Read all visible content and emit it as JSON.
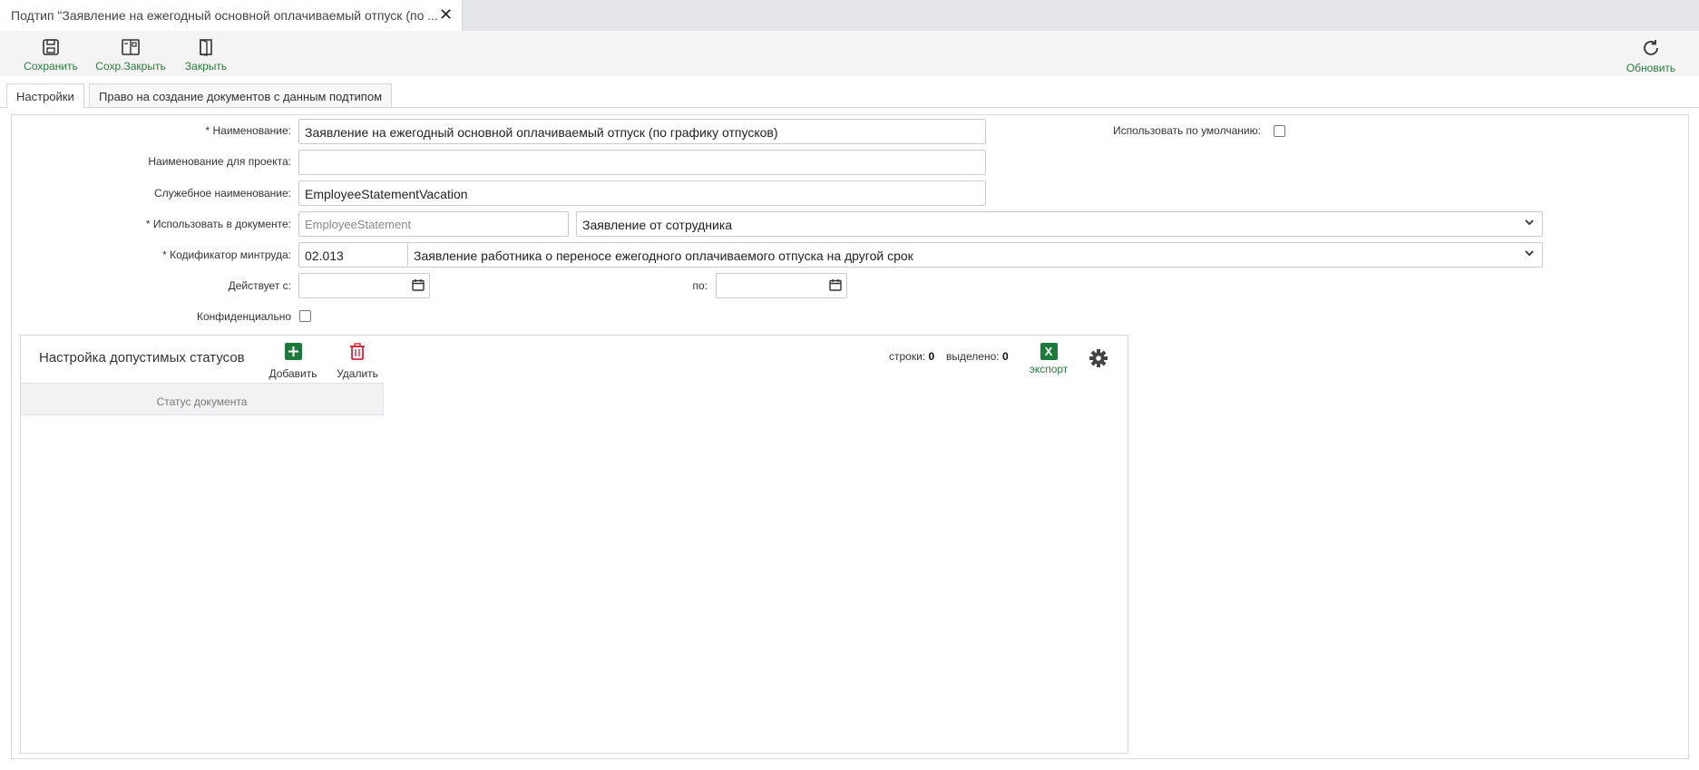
{
  "doc_tab": {
    "title": "Подтип \"Заявление на ежегодный основной оплачиваемый отпуск (по ..."
  },
  "toolbar": {
    "save_label": "Сохранить",
    "save_close_label": "Сохр.Закрыть",
    "close_label": "Закрыть",
    "refresh_label": "Обновить"
  },
  "tabs": [
    {
      "label": "Настройки",
      "active": true
    },
    {
      "label": "Право на создание документов с данным подтипом",
      "active": false
    }
  ],
  "form": {
    "name_label": "* Наименование:",
    "name_value": "Заявление на ежегодный основной оплачиваемый отпуск (по графику отпусков)",
    "default_label": "Использовать по умолчанию:",
    "default_checked": false,
    "project_name_label": "Наименование для проекта:",
    "project_name_value": "",
    "service_name_label": "Служебное наименование:",
    "service_name_value": "EmployeeStatementVacation",
    "use_in_doc_label": "* Использовать в документе:",
    "use_in_doc_code": "EmployeeStatement",
    "use_in_doc_value": "Заявление от сотрудника",
    "codifier_label": "* Кодификатор минтруда:",
    "codifier_code": "02.013",
    "codifier_value": "Заявление работника о переносе ежегодного оплачиваемого отпуска на другой срок",
    "valid_from_label": "Действует с:",
    "valid_from_value": "",
    "valid_to_label": "по:",
    "valid_to_value": "",
    "confidential_label": "Конфиденциально",
    "confidential_checked": false
  },
  "statuses_grid": {
    "title": "Настройка допустимых статусов",
    "add_label": "Добавить",
    "delete_label": "Удалить",
    "rows_label": "строки:",
    "rows_count": "0",
    "selected_label": "выделено:",
    "selected_count": "0",
    "export_label": "экспорт",
    "export_icon_text": "X",
    "column_header": "Статус документа",
    "rows": []
  },
  "colors": {
    "accent_green": "#2a7a3b",
    "delete_red": "#d0263a",
    "excel_green": "#1d7a3c"
  },
  "icons": [
    "save-icon",
    "save-close-icon",
    "close-door-icon",
    "refresh-icon",
    "calendar-icon",
    "plus-icon",
    "trash-icon",
    "excel-icon",
    "gear-icon",
    "chevron-down-icon",
    "close-icon"
  ]
}
